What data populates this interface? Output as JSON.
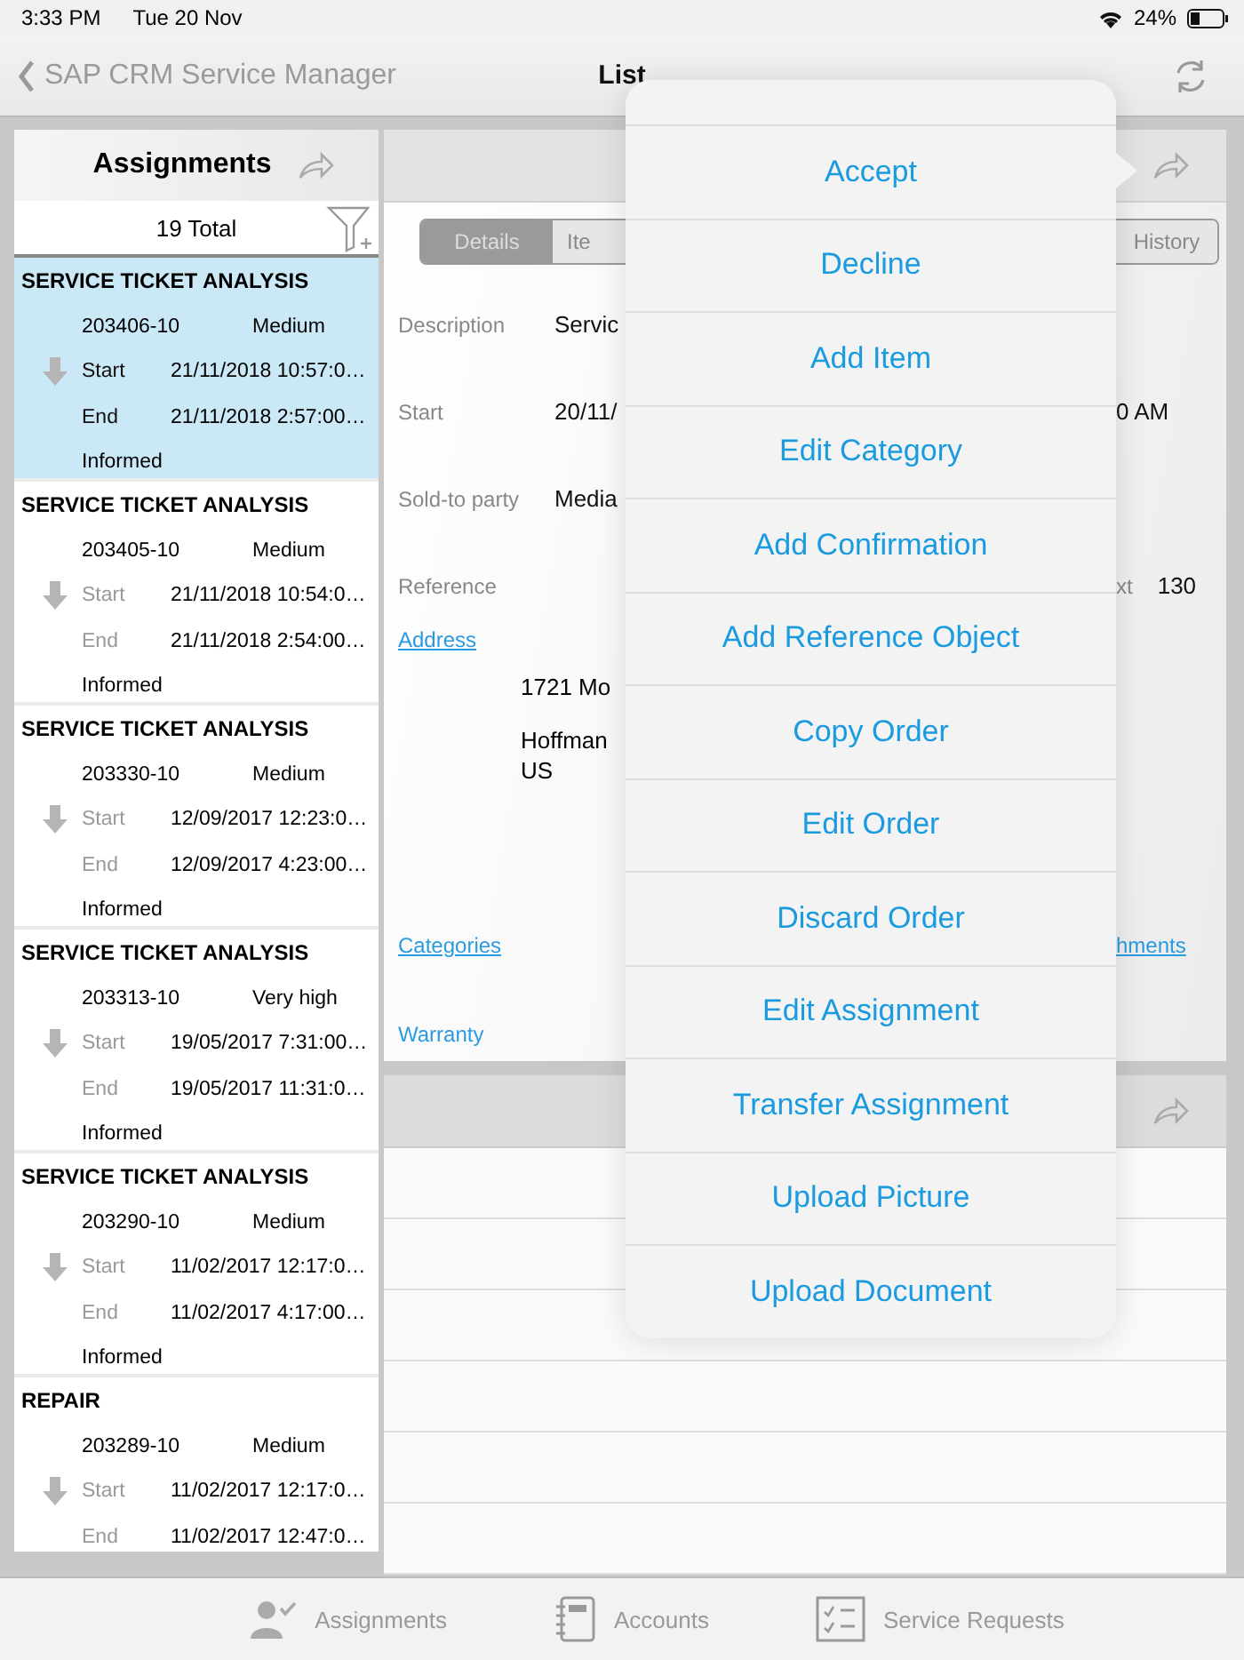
{
  "status_bar": {
    "time": "3:33 PM",
    "date": "Tue 20 Nov",
    "battery": "24%"
  },
  "nav": {
    "back_label": "SAP CRM Service Manager",
    "title": "List"
  },
  "assignments": {
    "title": "Assignments",
    "total": "19 Total",
    "items": [
      {
        "title": "SERVICE TICKET ANALYSIS",
        "number": "203406-10",
        "priority": "Medium",
        "start_label": "Start",
        "start": "21/11/2018 10:57:0…",
        "end_label": "End",
        "end": "21/11/2018 2:57:00…",
        "status": "Informed",
        "selected": true
      },
      {
        "title": "SERVICE TICKET ANALYSIS",
        "number": "203405-10",
        "priority": "Medium",
        "start_label": "Start",
        "start": "21/11/2018 10:54:0…",
        "end_label": "End",
        "end": "21/11/2018 2:54:00…",
        "status": "Informed",
        "selected": false
      },
      {
        "title": "SERVICE TICKET ANALYSIS",
        "number": "203330-10",
        "priority": "Medium",
        "start_label": "Start",
        "start": "12/09/2017 12:23:0…",
        "end_label": "End",
        "end": "12/09/2017 4:23:00…",
        "status": "Informed",
        "selected": false
      },
      {
        "title": "SERVICE TICKET ANALYSIS",
        "number": "203313-10",
        "priority": "Very high",
        "start_label": "Start",
        "start": "19/05/2017 7:31:00…",
        "end_label": "End",
        "end": "19/05/2017 11:31:0…",
        "status": "Informed",
        "selected": false
      },
      {
        "title": "SERVICE TICKET ANALYSIS",
        "number": "203290-10",
        "priority": "Medium",
        "start_label": "Start",
        "start": "11/02/2017 12:17:0…",
        "end_label": "End",
        "end": "11/02/2017 4:17:00…",
        "status": "Informed",
        "selected": false
      },
      {
        "title": "REPAIR",
        "number": "203289-10",
        "priority": "Medium",
        "start_label": "Start",
        "start": "11/02/2017 12:17:0…",
        "end_label": "End",
        "end": "11/02/2017 12:47:0…",
        "selected": false
      }
    ]
  },
  "detail": {
    "segments": [
      {
        "label": "Details",
        "selected": true
      },
      {
        "label": "Ite",
        "selected": false
      },
      {
        "label": "History",
        "selected": false
      }
    ],
    "fields": [
      {
        "label": "Description",
        "value": "Servic"
      },
      {
        "label": "Start",
        "value": "20/11/",
        "right_value": "0 AM"
      },
      {
        "label": "Sold-to party",
        "value": "Media"
      },
      {
        "label": "Reference",
        "right_label": "xt",
        "right_value": "130"
      }
    ],
    "address": {
      "link": "Address",
      "lines": [
        "1721 Mo",
        "Hoffman",
        "US"
      ]
    },
    "links": [
      {
        "label": "Categories",
        "underlined": true,
        "right": "hments"
      },
      {
        "label": "Warranty",
        "underlined": false
      }
    ]
  },
  "menu": [
    "Accept",
    "Decline",
    "Add Item",
    "Edit Category",
    "Add Confirmation",
    "Add Reference Object",
    "Copy Order",
    "Edit Order",
    "Discard Order",
    "Edit Assignment",
    "Transfer Assignment",
    "Upload Picture",
    "Upload Document"
  ],
  "tab_bar": [
    {
      "kind": "assignments",
      "label": "Assignments"
    },
    {
      "kind": "accounts",
      "label": "Accounts"
    },
    {
      "kind": "requests",
      "label": "Service Requests"
    }
  ]
}
